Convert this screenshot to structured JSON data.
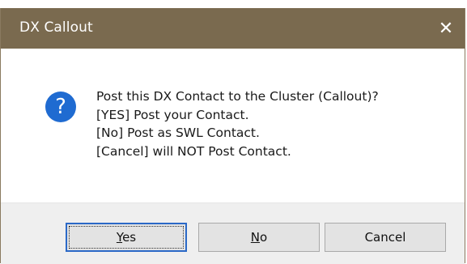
{
  "window": {
    "title": "DX Callout",
    "close_glyph": "✕"
  },
  "icon": {
    "name": "question-icon",
    "glyph": "?",
    "color": "#1f6bd1"
  },
  "message": {
    "lines": [
      "Post this DX Contact to the Cluster (Callout)?",
      "[YES] Post your Contact.",
      "[No] Post as SWL Contact.",
      "[Cancel] will NOT Post Contact."
    ]
  },
  "buttons": {
    "yes": {
      "accel": "Y",
      "rest": "es"
    },
    "no": {
      "accel": "N",
      "rest": "o"
    },
    "cancel": {
      "label": "Cancel"
    }
  },
  "colors": {
    "titlebar": "#7a6a4f",
    "footer": "#efefef",
    "default_button_border": "#2b69c7"
  }
}
